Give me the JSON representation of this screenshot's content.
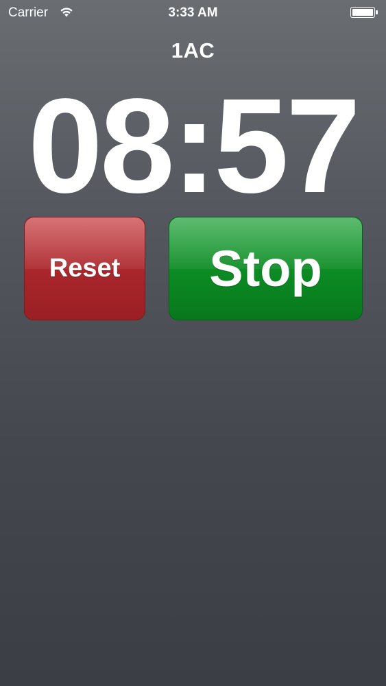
{
  "status_bar": {
    "carrier": "Carrier",
    "time": "3:33 AM",
    "wifi_icon": "wifi-icon",
    "battery_icon": "battery-icon"
  },
  "session": {
    "name": "1AC"
  },
  "timer": {
    "display": "08:57"
  },
  "controls": {
    "reset_label": "Reset",
    "stop_label": "Stop"
  },
  "colors": {
    "reset": "#a8262b",
    "stop": "#0c8a23",
    "background": "#4a4d53",
    "text": "#ffffff"
  }
}
